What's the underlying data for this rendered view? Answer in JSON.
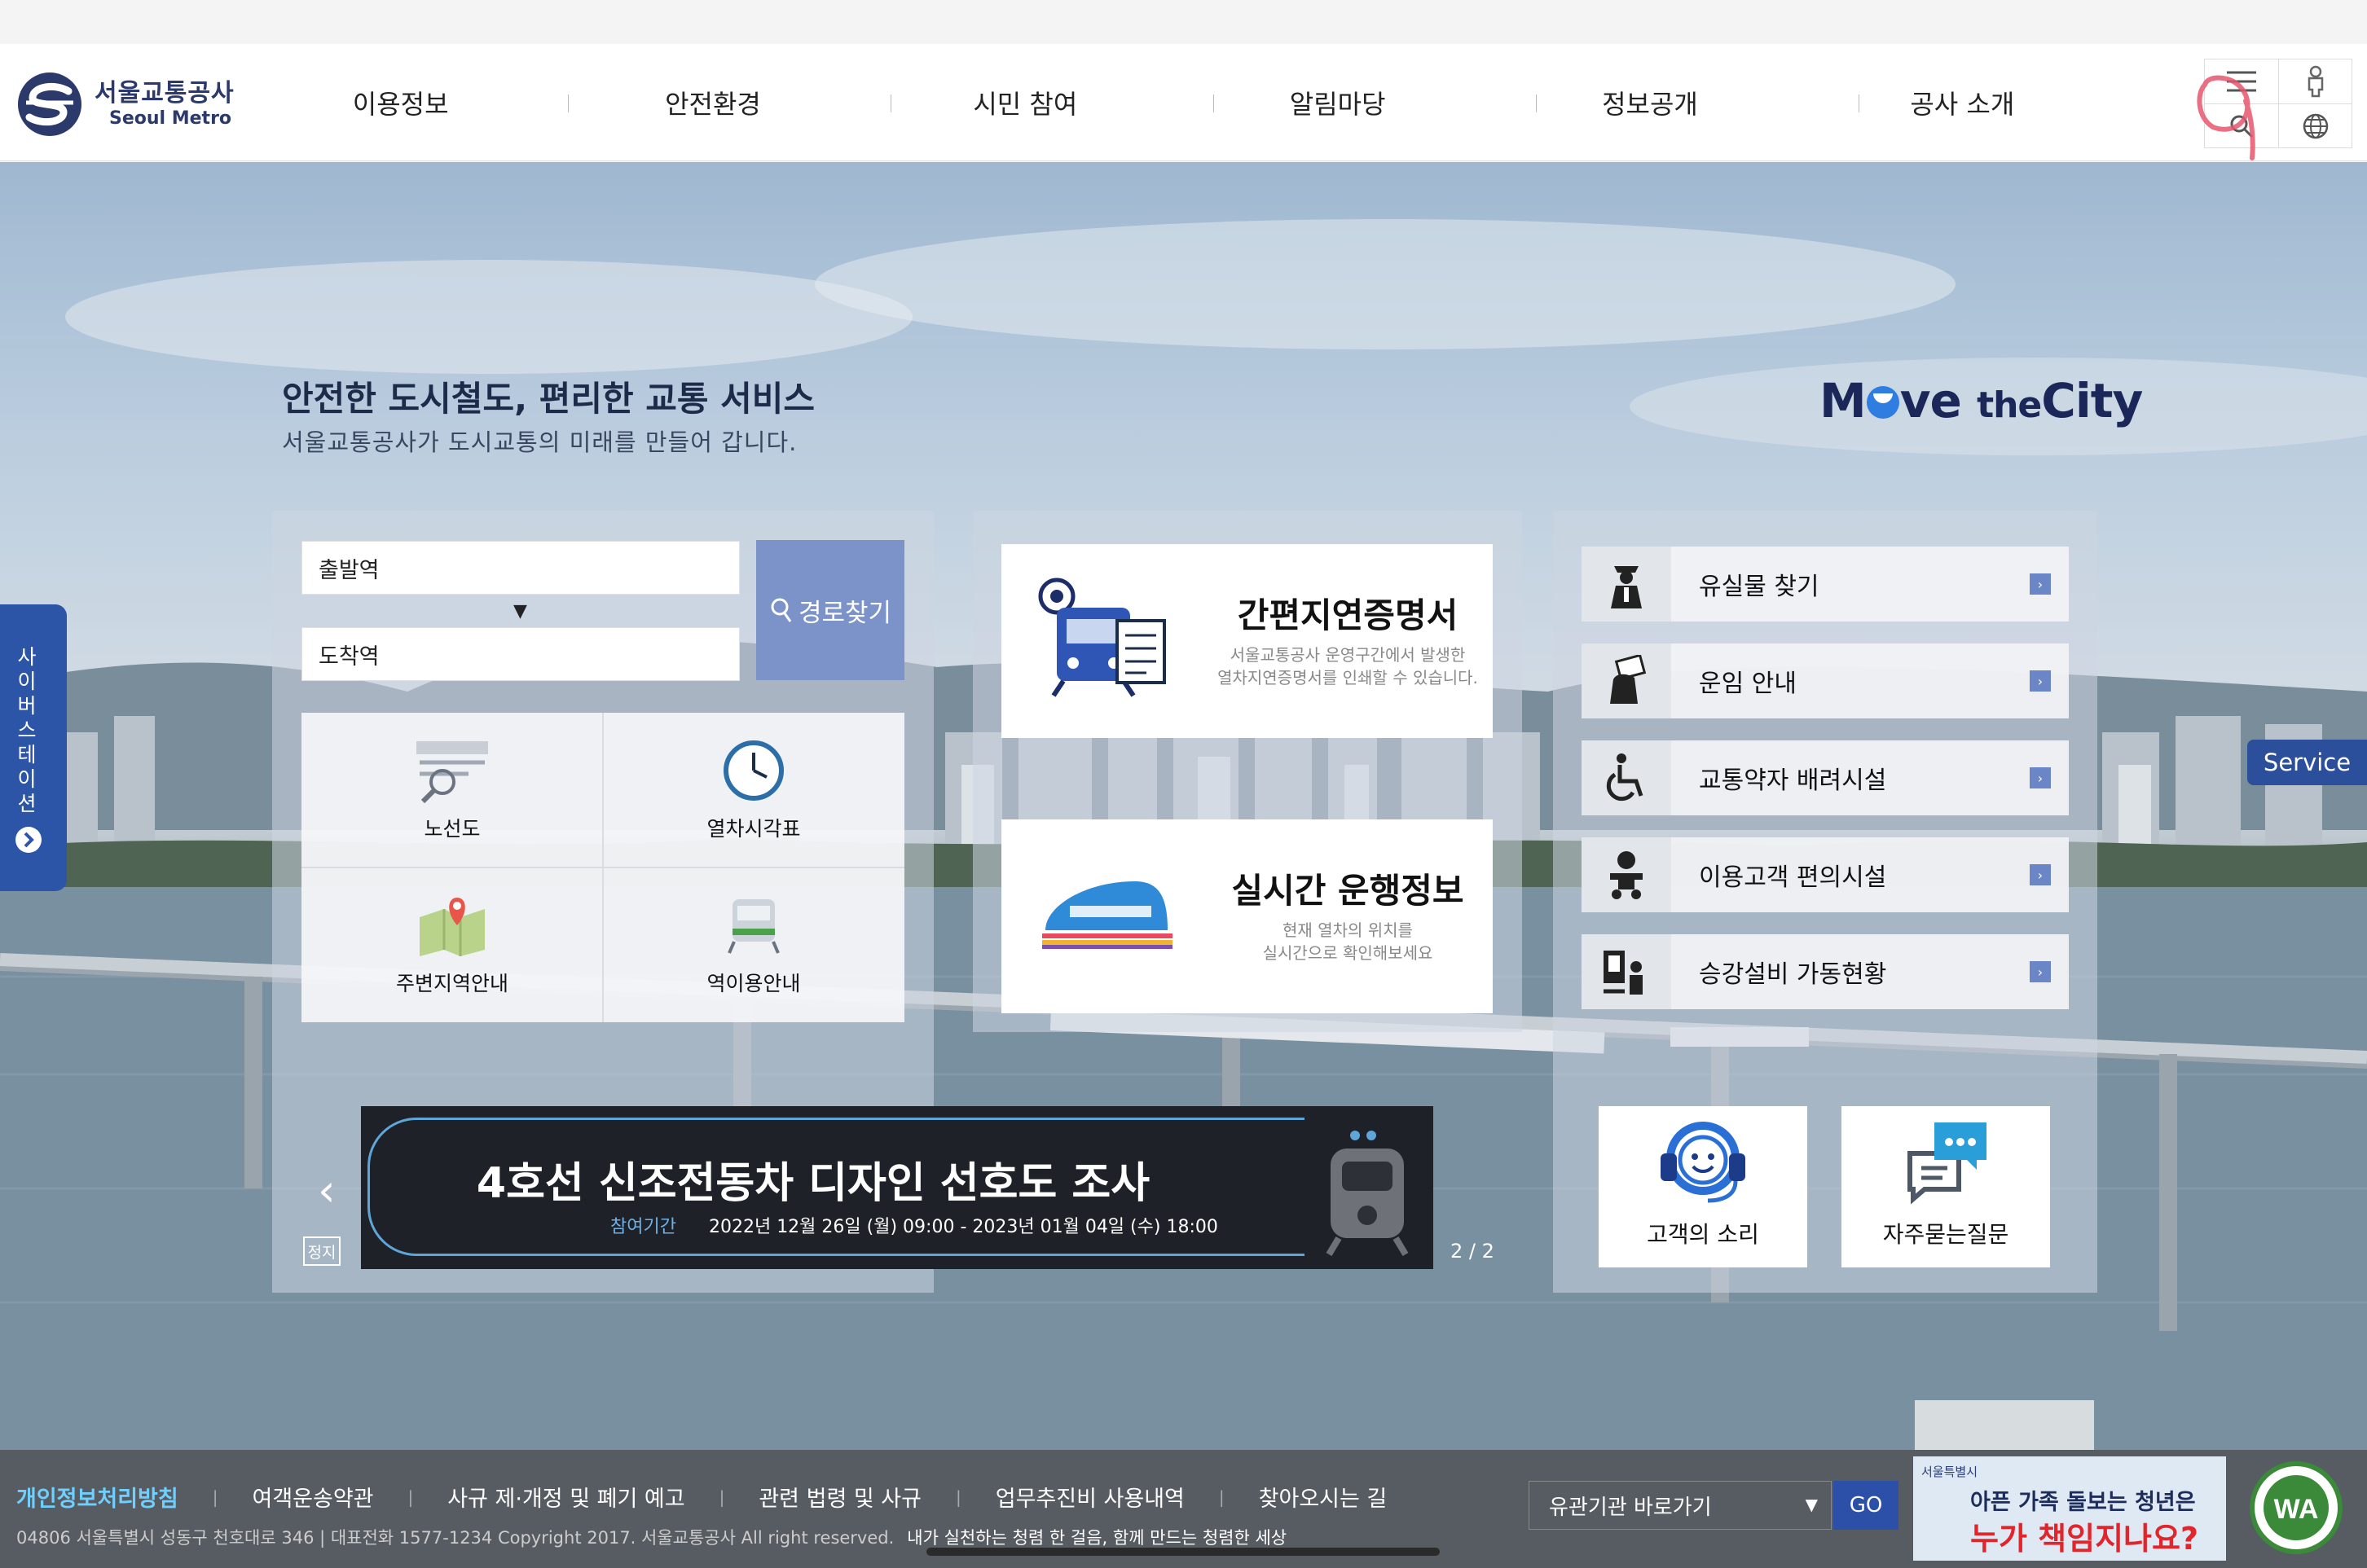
{
  "header": {
    "logo_ko": "서울교통공사",
    "logo_en": "Seoul Metro",
    "nav": [
      "이용정보",
      "안전환경",
      "시민 참여",
      "알림마당",
      "정보공개",
      "공사 소개"
    ],
    "tools": [
      "menu-icon",
      "accessibility-person-icon",
      "search-icon",
      "globe-icon"
    ]
  },
  "hero": {
    "title": "안전한 도시철도, 편리한 교통 서비스",
    "subtitle": "서울교통공사가 도시교통의 미래를 만들어 갑니다.",
    "brand_move": "M",
    "brand_ve": "ve",
    "brand_the": "the",
    "brand_city": "City"
  },
  "route": {
    "departure": "출발역",
    "arrival": "도착역",
    "search_label": "경로찾기",
    "quick": [
      {
        "label": "노선도",
        "icon": "route-map-icon"
      },
      {
        "label": "열차시각표",
        "icon": "clock-icon"
      },
      {
        "label": "주변지역안내",
        "icon": "map-pin-icon"
      },
      {
        "label": "역이용안내",
        "icon": "train-icon"
      }
    ]
  },
  "cert": {
    "title": "간편지연증명서",
    "desc_line1": "서울교통공사 운영구간에서 발생한",
    "desc_line2": "열차지연증명서를 인쇄할 수 있습니다."
  },
  "realtime": {
    "title": "실시간 운행정보",
    "desc_line1": "현재 열차의 위치를",
    "desc_line2": "실시간으로 확인해보세요"
  },
  "services": [
    {
      "label": "유실물 찾기",
      "icon": "officer-icon"
    },
    {
      "label": "운임 안내",
      "icon": "ticket-hand-icon"
    },
    {
      "label": "교통약자 배려시설",
      "icon": "wheelchair-icon"
    },
    {
      "label": "이용고객 편의시설",
      "icon": "baby-icon"
    },
    {
      "label": "승강설비 가동현황",
      "icon": "elevator-icon"
    }
  ],
  "help": {
    "voice": "고객의 소리",
    "faq": "자주묻는질문"
  },
  "banner": {
    "title": "4호선 신조전동차 디자인 선호도 조사",
    "period_key": "참여기간",
    "period": "2022년 12월 26일 (월) 09:00 - 2023년 01월 04일 (수) 18:00",
    "stop": "정지",
    "counter": "2 / 2",
    "prev": "‹"
  },
  "side": {
    "cyber": "사이버스테이션",
    "service": "Service"
  },
  "footer": {
    "links": [
      "개인정보처리방침",
      "여객운송약관",
      "사규 제·개정 및 폐기 예고",
      "관련 법령 및 사규",
      "업무추진비 사용내역",
      "찾아오시는 길"
    ],
    "copy": "04806 서울특별시 성동구 천호대로 346 | 대표전화 1577-1234 Copyright 2017. 서울교통공사 All right reserved.",
    "slogan": "내가 실천하는 청렴 한 걸음, 함께 만드는 청렴한 세상",
    "related": "유관기관 바로가기",
    "go": "GO",
    "ad_top": "서울특별시",
    "ad_line1": "아픈 가족 돌보는 청년은",
    "ad_line2": "누가 책임지나요?"
  },
  "colors": {
    "brand": "#2b3a6b",
    "accent": "#2c55a8",
    "route_button": "#7b93c9",
    "footer_bg": "#565c61",
    "footer_highlight": "#6fd0ff"
  }
}
